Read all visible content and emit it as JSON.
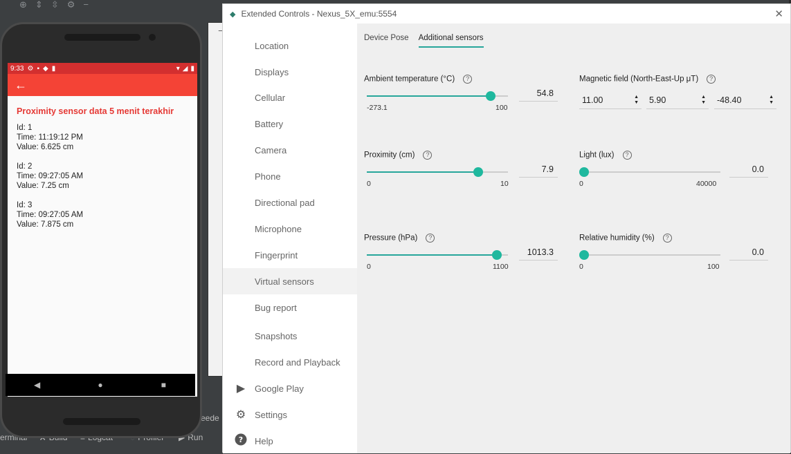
{
  "phone": {
    "status_time": "9:33",
    "title": "Proximity sensor data 5 menit terakhir",
    "records": [
      {
        "id": "Id: 1",
        "time": "Time: 11:19:12 PM",
        "value": "Value: 6.625 cm"
      },
      {
        "id": "Id: 2",
        "time": "Time: 09:27:05 AM",
        "value": "Value: 7.25 cm"
      },
      {
        "id": "Id: 3",
        "time": "Time: 09:27:05 AM",
        "value": "Value: 7.875 cm"
      }
    ]
  },
  "toolbar": {
    "icons": [
      "power-icon",
      "volume-up-icon",
      "volume-down-icon",
      "rotate-left-icon",
      "rotate-right-icon",
      "camera-icon",
      "zoom-icon",
      "back-icon",
      "home-icon",
      "overview-icon",
      "more-icon"
    ],
    "more_glyph": "•••"
  },
  "window": {
    "title": "Extended Controls - Nexus_5X_emu:5554",
    "close": "✕"
  },
  "nav": [
    {
      "label": "Location",
      "icon": "location-icon"
    },
    {
      "label": "Displays",
      "icon": "displays-icon"
    },
    {
      "label": "Cellular",
      "icon": "cellular-icon"
    },
    {
      "label": "Battery",
      "icon": "battery-icon"
    },
    {
      "label": "Camera",
      "icon": "camera-icon"
    },
    {
      "label": "Phone",
      "icon": "phone-icon"
    },
    {
      "label": "Directional pad",
      "icon": "dpad-icon"
    },
    {
      "label": "Microphone",
      "icon": "microphone-icon"
    },
    {
      "label": "Fingerprint",
      "icon": "fingerprint-icon"
    },
    {
      "label": "Virtual sensors",
      "icon": "sensors-icon",
      "active": true
    },
    {
      "label": "Bug report",
      "icon": "bug-icon"
    },
    {
      "label": "Snapshots",
      "icon": "snapshot-icon"
    },
    {
      "label": "Record and Playback",
      "icon": "record-icon"
    },
    {
      "label": "Google Play",
      "icon": "play-icon"
    },
    {
      "label": "Settings",
      "icon": "gear-icon"
    },
    {
      "label": "Help",
      "icon": "help-icon"
    }
  ],
  "tabs": {
    "device_pose": "Device Pose",
    "additional_sensors": "Additional sensors"
  },
  "sensors": {
    "ambient_temperature": {
      "label": "Ambient temperature (°C)",
      "min": "-273.1",
      "max": "100",
      "value": "54.8",
      "fraction": 0.879
    },
    "proximity": {
      "label": "Proximity (cm)",
      "min": "0",
      "max": "10",
      "value": "7.9",
      "fraction": 0.79
    },
    "pressure": {
      "label": "Pressure (hPa)",
      "min": "0",
      "max": "1100",
      "value": "1013.3",
      "fraction": 0.921
    },
    "magnetic_field": {
      "label": "Magnetic field (North-East-Up μT)",
      "north": "11.00",
      "east": "5.90",
      "up": "-48.40"
    },
    "light": {
      "label": "Light (lux)",
      "min": "0",
      "max": "40000",
      "value": "0.0",
      "fraction": 0.0
    },
    "humidity": {
      "label": "Relative humidity (%)",
      "min": "0",
      "max": "100",
      "value": "0.0",
      "fraction": 0.0
    }
  },
  "ide": {
    "bottom_items": [
      "erminal",
      "Build",
      "Logcat",
      "Profiler",
      "Run"
    ],
    "fragment": "ceede"
  },
  "colors": {
    "accent": "#26a69a",
    "app_bar": "#f44336",
    "status_bar": "#d32f2f",
    "title_red": "#e53935"
  }
}
